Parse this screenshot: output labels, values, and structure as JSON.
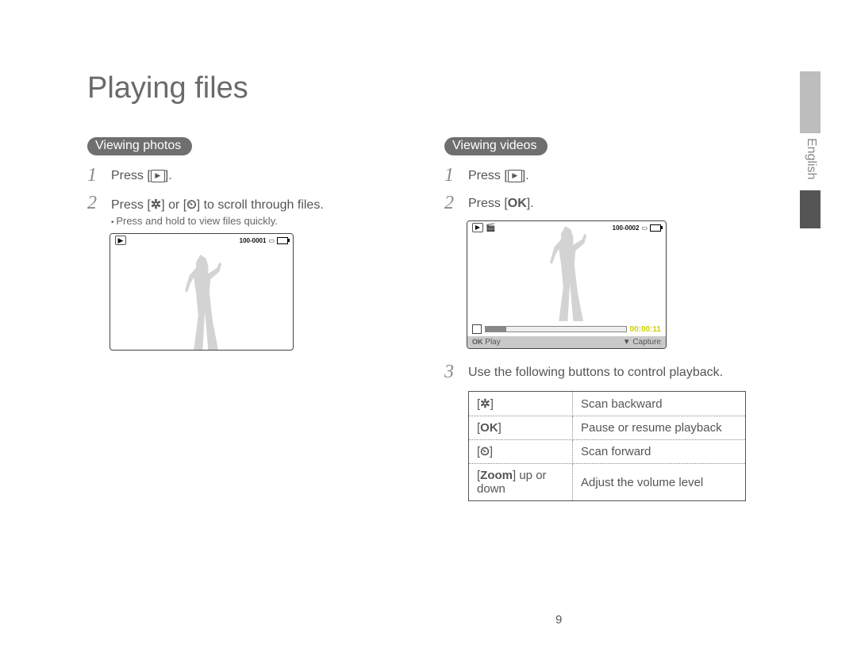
{
  "title": "Playing files",
  "language_tab": "English",
  "page_number": "9",
  "left": {
    "heading": "Viewing photos",
    "step1": "Press [",
    "step1_end": "].",
    "step2_a": "Press [",
    "step2_b": "] or [",
    "step2_c": "] to scroll through files.",
    "step2_sub": "Press and hold to view files quickly.",
    "screen_counter": "100-0001"
  },
  "right": {
    "heading": "Viewing videos",
    "step1": "Press [",
    "step1_end": "].",
    "step2": "Press [",
    "step2_end": "].",
    "screen_counter": "100-0002",
    "screen_time": "00:00:11",
    "screen_play": "Play",
    "screen_capture": "Capture",
    "step3": "Use the following buttons to control playback.",
    "table": [
      {
        "icon": "flash",
        "label": "Scan backward"
      },
      {
        "icon": "OK",
        "label": "Pause or resume playback"
      },
      {
        "icon": "timer",
        "label": "Scan forward"
      },
      {
        "icon": "zoom",
        "zoom_text_a": "Zoom",
        "zoom_text_b": " up or down",
        "label": "Adjust the volume level"
      }
    ]
  }
}
